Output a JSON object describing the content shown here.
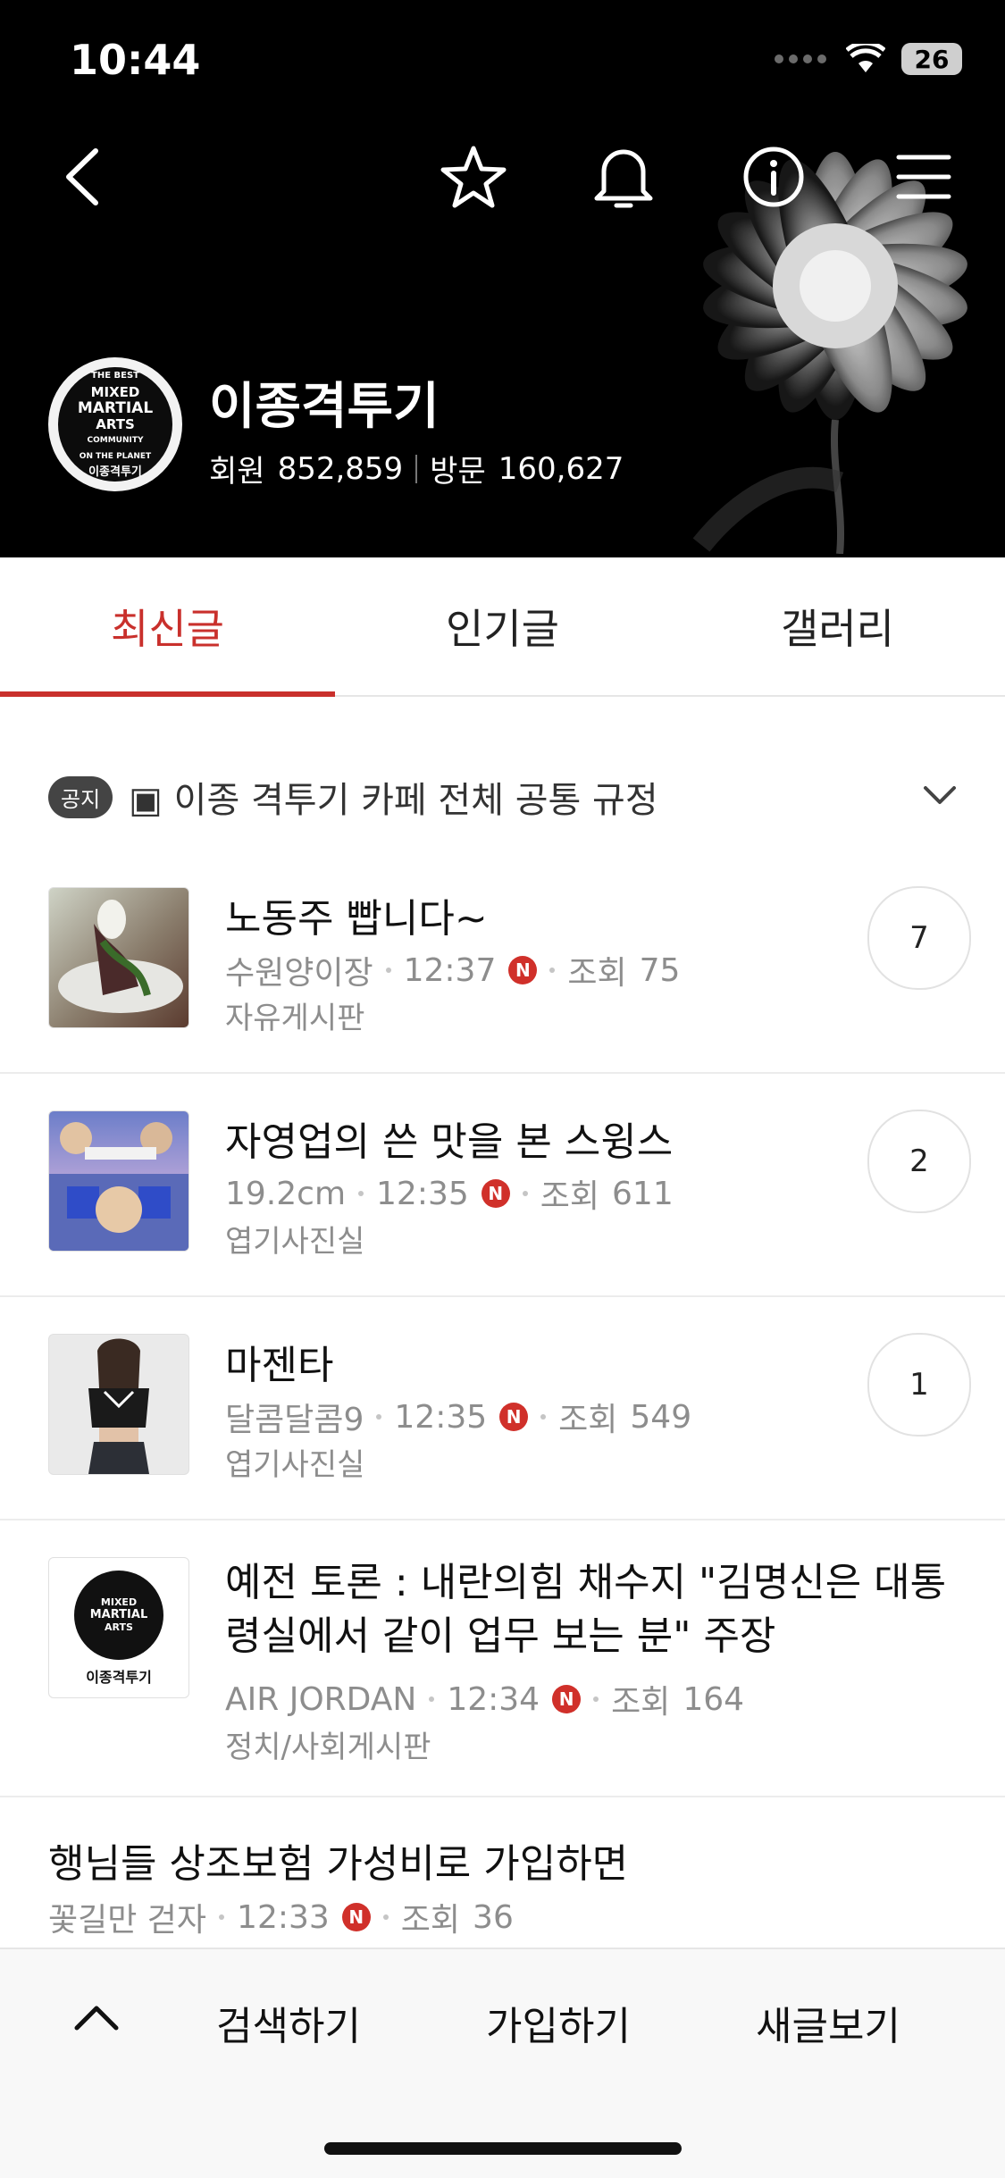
{
  "status_bar": {
    "time": "10:44",
    "battery": "26"
  },
  "header": {
    "cafe_name": "이종격투기",
    "members_label": "회원",
    "members_count": "852,859",
    "visits_label": "방문",
    "visits_count": "160,627",
    "logo_lines": [
      "THE BEST",
      "MIXED",
      "MARTIAL",
      "ARTS",
      "COMMUNITY",
      "ON THE PLANET",
      "이종격투기"
    ]
  },
  "tabs": [
    {
      "label": "최신글",
      "active": true
    },
    {
      "label": "인기글",
      "active": false
    },
    {
      "label": "갤러리",
      "active": false
    }
  ],
  "notice": {
    "badge": "공지",
    "text": "▣ 이종 격투기 카페 전체 공통 규정"
  },
  "posts": [
    {
      "title": "노동주 빱니다~",
      "author": "수원양이장",
      "time": "12:37",
      "new_badge": "N",
      "views_label": "조회",
      "views": "75",
      "board": "자유게시판",
      "comments": "7"
    },
    {
      "title": "자영업의 쓴 맛을 본 스윙스",
      "author": "19.2cm",
      "time": "12:35",
      "new_badge": "N",
      "views_label": "조회",
      "views": "611",
      "board": "엽기사진실",
      "comments": "2"
    },
    {
      "title": "마젠타",
      "author": "달콤달콤9",
      "time": "12:35",
      "new_badge": "N",
      "views_label": "조회",
      "views": "549",
      "board": "엽기사진실",
      "comments": "1"
    },
    {
      "title_line1": "예전 토론 : 내란의힘 채수지 \"김명신은 대통",
      "title_line2": "령실에서 같이 업무 보는 분\" 주장",
      "author": "AIR JORDAN",
      "time": "12:34",
      "new_badge": "N",
      "views_label": "조회",
      "views": "164",
      "board": "정치/사회게시판"
    },
    {
      "title": "행님들 상조보험 가성비로 가입하면",
      "author": "꽃길만 걷자",
      "time": "12:33",
      "new_badge": "N",
      "views_label": "조회",
      "views": "36"
    }
  ],
  "bottom_bar": {
    "search": "검색하기",
    "join": "가입하기",
    "new_posts": "새글보기"
  },
  "colors": {
    "accent": "#c9302c",
    "new_badge": "#d0302a"
  }
}
